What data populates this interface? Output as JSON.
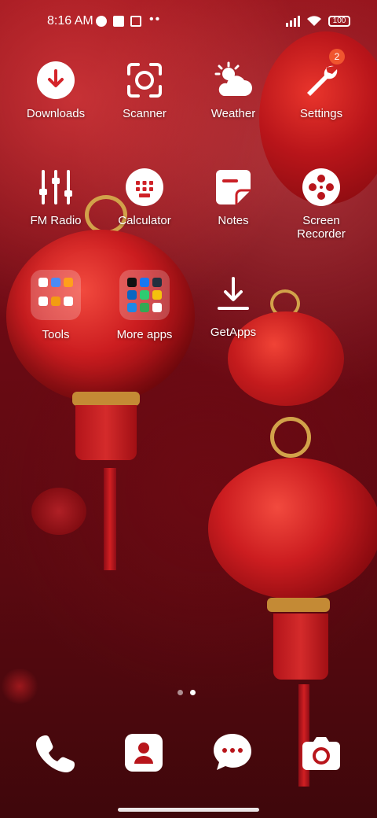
{
  "status_bar": {
    "time": "8:16 AM",
    "battery": "100",
    "icons": [
      "moon-icon",
      "square-icon",
      "upload-icon",
      "more-icon",
      "signal-icon",
      "wifi-icon",
      "battery-icon"
    ]
  },
  "apps": [
    {
      "label": "Downloads",
      "icon": "download-icon"
    },
    {
      "label": "Scanner",
      "icon": "scanner-icon"
    },
    {
      "label": "Weather",
      "icon": "weather-icon"
    },
    {
      "label": "Settings",
      "icon": "wrench-icon",
      "badge": "2"
    },
    {
      "label": "FM Radio",
      "icon": "equalizer-icon"
    },
    {
      "label": "Calculator",
      "icon": "calculator-icon"
    },
    {
      "label": "Notes",
      "icon": "notes-icon"
    },
    {
      "label": "Screen Recorder",
      "icon": "film-reel-icon"
    },
    {
      "label": "GetApps",
      "icon": "getapps-download-icon"
    }
  ],
  "folders": [
    {
      "label": "Tools",
      "icon_colors": [
        "#ffffff",
        "#4b8bf5",
        "#ff9f1c",
        "#ffffff",
        "#f39c12",
        "#ffffff"
      ]
    },
    {
      "label": "More apps",
      "icon_colors": [
        "#111111",
        "#1877f2",
        "#232f3e",
        "#0a66c2",
        "#2ecc71",
        "#f4c20d",
        "#1e88e5",
        "#34a853",
        "#ffffff"
      ]
    }
  ],
  "dock": [
    {
      "icon": "phone-icon"
    },
    {
      "icon": "contacts-icon"
    },
    {
      "icon": "messages-icon"
    },
    {
      "icon": "camera-icon"
    }
  ],
  "page_indicator": {
    "pages": 2,
    "current": 2
  },
  "colors": {
    "badge": "#f0552f",
    "text": "#ffffff"
  }
}
